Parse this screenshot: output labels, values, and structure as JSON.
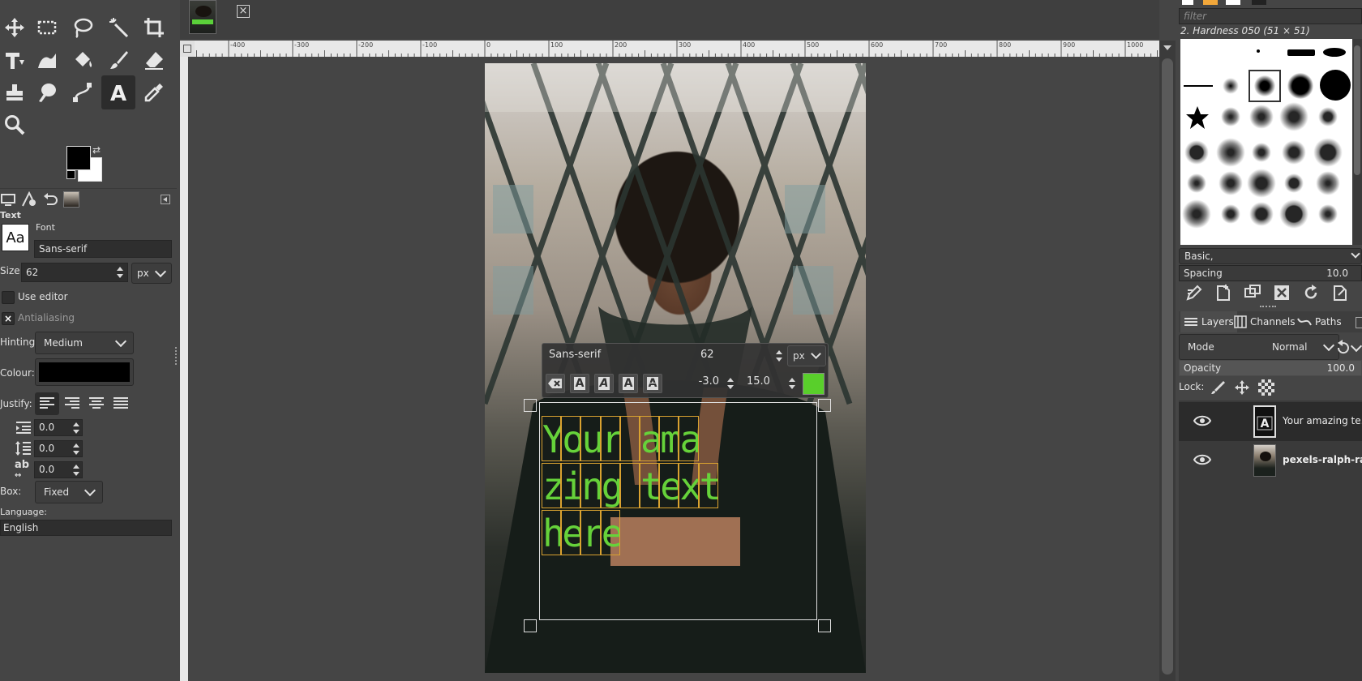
{
  "image_tab": {
    "close_icon": "close-icon"
  },
  "toolbox": {
    "tools": [
      "move-tool-icon",
      "rect-select-icon",
      "lasso-icon",
      "fuzzy-select-icon",
      "crop-icon",
      "unified-transform-icon",
      "warp-icon",
      "bucket-fill-icon",
      "paintbrush-icon",
      "eraser-icon",
      "clone-icon",
      "smudge-icon",
      "paths-icon",
      "text-tool-icon",
      "color-picker-icon",
      "zoom-icon"
    ],
    "fg_color": "#000000",
    "bg_color": "#ffffff"
  },
  "tool_options": {
    "title": "Text",
    "font_label": "Font",
    "font_preview": "Aa",
    "font_value": "Sans-serif",
    "size_label": "Size:",
    "size_value": "62",
    "size_unit": "px",
    "use_editor_label": "Use editor",
    "antialiasing_label": "Antialiasing",
    "hinting_label": "Hinting:",
    "hinting_value": "Medium",
    "colour_label": "Colour:",
    "colour_value": "#000000",
    "justify_label": "Justify:",
    "indent_value": "0.0",
    "line_spacing_value": "0.0",
    "letter_spacing_value": "0.0",
    "box_label": "Box:",
    "box_value": "Fixed",
    "language_label": "Language:",
    "language_value": "English"
  },
  "ruler": {
    "labels": [
      "-400",
      "-300",
      "-200",
      "-100",
      "0",
      "100",
      "200",
      "300",
      "400",
      "500",
      "600",
      "700",
      "800",
      "900",
      "1000"
    ]
  },
  "on_canvas_toolbar": {
    "font": "Sans-serif",
    "size": "62",
    "unit": "px",
    "baseline": "-3.0",
    "kerning": "15.0",
    "color": "#59cf2b"
  },
  "text_layer": {
    "lines": [
      "Your ama",
      "zing text",
      "here"
    ],
    "color": "#66d23a"
  },
  "brushes": {
    "filter_placeholder": "filter",
    "current": "2. Hardness 050 (51 × 51)",
    "preset": "Basic,",
    "spacing_label": "Spacing",
    "spacing_value": "10.0"
  },
  "layers_panel": {
    "tabs": [
      "Layers",
      "Channels",
      "Paths"
    ],
    "mode_label": "Mode",
    "mode_value": "Normal",
    "opacity_label": "Opacity",
    "opacity_value": "100.0",
    "lock_label": "Lock:",
    "layers": [
      {
        "name": "Your amazing te..."
      },
      {
        "name": "pexels-ralph-raba"
      }
    ]
  }
}
